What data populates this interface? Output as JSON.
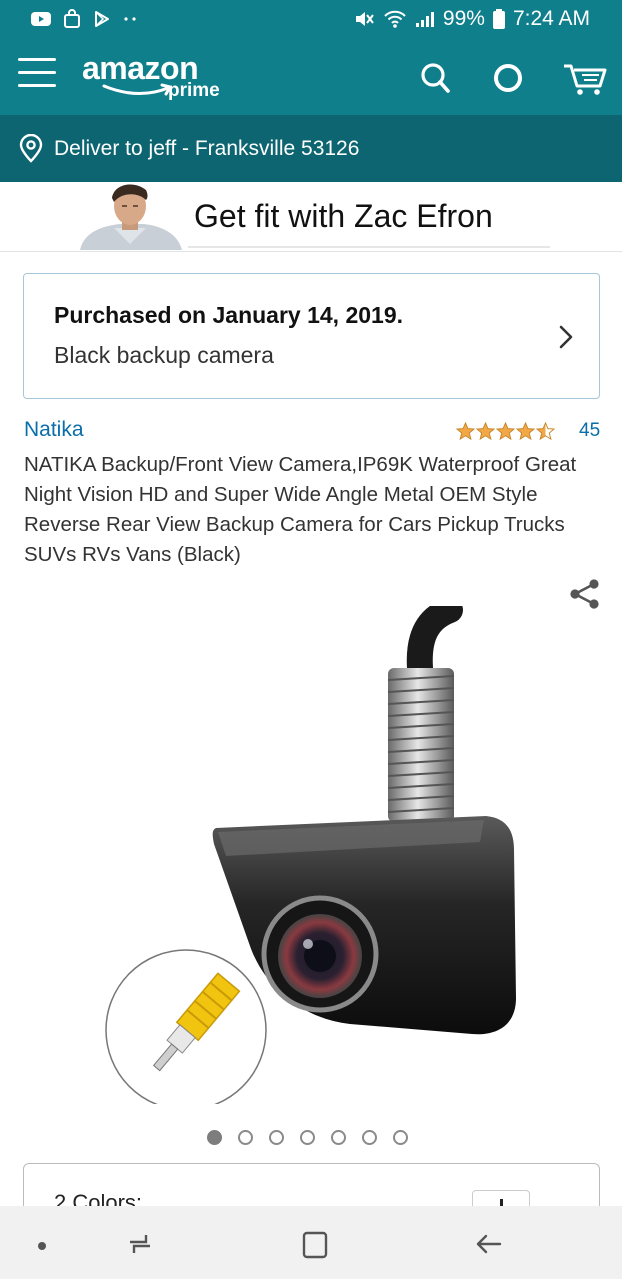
{
  "status_bar": {
    "battery": "99%",
    "time": "7:24 AM",
    "icons": [
      "youtube-icon",
      "shopping-bag-icon",
      "play-store-icon",
      "more-dots-icon",
      "mute-icon",
      "wifi-icon",
      "signal-icon",
      "battery-icon"
    ]
  },
  "header": {
    "logo_main": "amazon",
    "logo_sub": "prime",
    "icons": [
      "menu-icon",
      "search-icon",
      "alexa-icon",
      "cart-icon"
    ],
    "color": "#0f7f8c"
  },
  "deliver": {
    "text": "Deliver to jeff - Franksville 53126",
    "color": "#0c6570"
  },
  "banner": {
    "text": "Get fit with Zac Efron"
  },
  "purchase": {
    "title": "Purchased on January 14, 2019.",
    "subtitle": "Black backup camera"
  },
  "product": {
    "brand": "Natika",
    "rating_stars": 4.5,
    "review_count": "45",
    "title": "NATIKA Backup/Front View Camera,IP69K Waterproof Great Night Vision HD and Super Wide Angle Metal OEM Style Reverse Rear View Backup Camera for Cars Pickup Trucks SUVs RVs Vans (Black)",
    "image_count": 7,
    "active_image": 1
  },
  "colors": {
    "label": "2 Colors:"
  },
  "nav_bar": {
    "icons": [
      "dot-icon",
      "recent-apps-icon",
      "home-icon",
      "back-icon"
    ]
  }
}
